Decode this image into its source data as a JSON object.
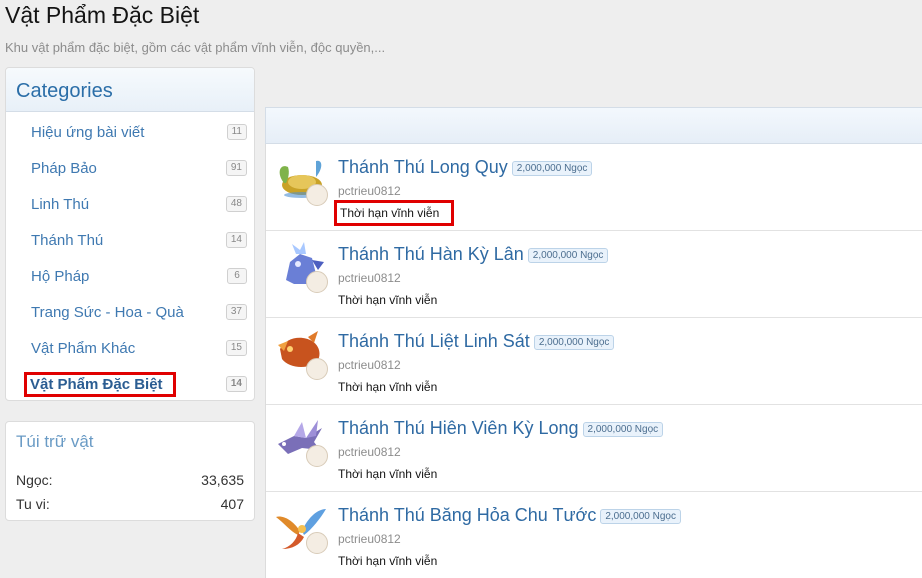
{
  "page": {
    "title": "Vật Phẩm Đặc Biệt",
    "description": "Khu vật phẩm đặc biệt, gồm các vật phẩm vĩnh viễn, độc quyền,..."
  },
  "categories": {
    "title": "Categories",
    "items": [
      {
        "label": "Hiệu ứng bài viết",
        "count": "11"
      },
      {
        "label": "Pháp Bảo",
        "count": "91"
      },
      {
        "label": "Linh Thú",
        "count": "48"
      },
      {
        "label": "Thánh Thú",
        "count": "14"
      },
      {
        "label": "Hộ Pháp",
        "count": "6"
      },
      {
        "label": "Trang Sức - Hoa - Quà",
        "count": "37"
      },
      {
        "label": "Vật Phẩm Khác",
        "count": "15"
      },
      {
        "label": "Vật Phẩm Đặc Biệt",
        "count": "14",
        "active": true
      }
    ]
  },
  "inventory": {
    "title": "Túi trữ vật",
    "rows": [
      {
        "label": "Ngọc:",
        "value": "33,635"
      },
      {
        "label": "Tu vi:",
        "value": "407"
      }
    ]
  },
  "items": [
    {
      "name": "Thánh Thú Long Quy",
      "price": "2,000,000 Ngọc",
      "user": "pctrieu0812",
      "term": "Thời hạn vĩnh viễn",
      "icon": "turtle-dragon-icon",
      "color": "#c9a227"
    },
    {
      "name": "Thánh Thú Hàn Kỳ Lân",
      "price": "2,000,000 Ngọc",
      "user": "pctrieu0812",
      "term": "Thời hạn vĩnh viễn",
      "icon": "ice-qilin-icon",
      "color": "#6a7fd6"
    },
    {
      "name": "Thánh Thú Liệt Linh Sát",
      "price": "2,000,000 Ngọc",
      "user": "pctrieu0812",
      "term": "Thời hạn vĩnh viễn",
      "icon": "fire-beast-icon",
      "color": "#c8531e"
    },
    {
      "name": "Thánh Thú Hiên Viên Kỳ Long",
      "price": "2,000,000 Ngọc",
      "user": "pctrieu0812",
      "term": "Thời hạn vĩnh viễn",
      "icon": "sky-dragon-icon",
      "color": "#7a6fb8"
    },
    {
      "name": "Thánh Thú Băng Hỏa Chu Tước",
      "price": "2,000,000 Ngọc",
      "user": "pctrieu0812",
      "term": "Thời hạn vĩnh viễn",
      "icon": "phoenix-icon",
      "color": "#e08a2a"
    }
  ]
}
